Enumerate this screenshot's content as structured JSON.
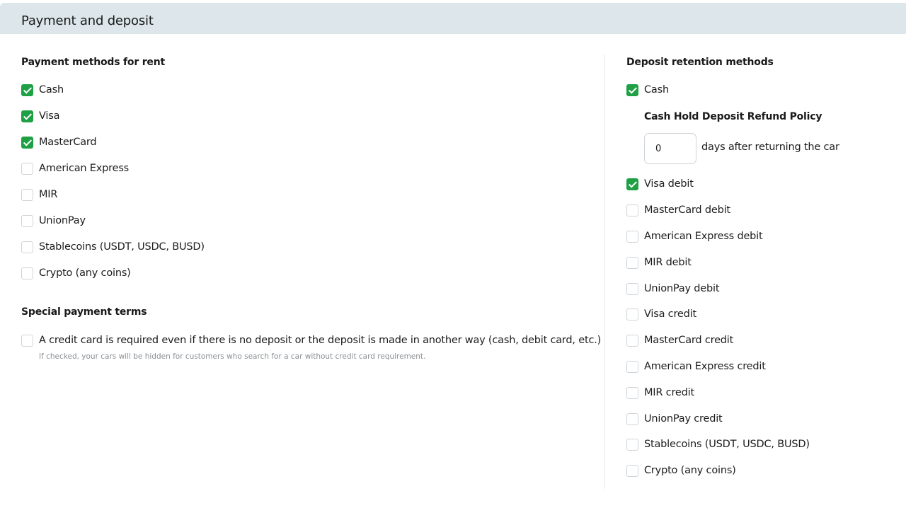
{
  "header": {
    "title": "Payment and deposit"
  },
  "payment_methods": {
    "title": "Payment methods for rent",
    "items": [
      {
        "label": "Cash",
        "checked": true
      },
      {
        "label": "Visa",
        "checked": true
      },
      {
        "label": "MasterCard",
        "checked": true
      },
      {
        "label": "American Express",
        "checked": false
      },
      {
        "label": "MIR",
        "checked": false
      },
      {
        "label": "UnionPay",
        "checked": false
      },
      {
        "label": "Stablecoins (USDT, USDC, BUSD)",
        "checked": false
      },
      {
        "label": "Crypto (any coins)",
        "checked": false
      }
    ]
  },
  "special_terms": {
    "title": "Special payment terms",
    "credit_card_required": {
      "label": "A credit card is required even if there is no deposit or the deposit is made in another way (cash, debit card, etc.)",
      "checked": false,
      "hint": "If checked, your cars will be hidden for customers who search for a car without credit card requirement."
    }
  },
  "deposit_methods": {
    "title": "Deposit retention methods",
    "cash": {
      "label": "Cash",
      "checked": true
    },
    "refund_policy": {
      "title": "Cash Hold Deposit Refund Policy",
      "days_value": "0",
      "suffix": "days after returning the car"
    },
    "items": [
      {
        "label": "Visa debit",
        "checked": true
      },
      {
        "label": "MasterCard debit",
        "checked": false
      },
      {
        "label": "American Express debit",
        "checked": false
      },
      {
        "label": "MIR debit",
        "checked": false
      },
      {
        "label": "UnionPay debit",
        "checked": false
      },
      {
        "label": "Visa credit",
        "checked": false
      },
      {
        "label": "MasterCard credit",
        "checked": false
      },
      {
        "label": "American Express credit",
        "checked": false
      },
      {
        "label": "MIR credit",
        "checked": false
      },
      {
        "label": "UnionPay credit",
        "checked": false
      },
      {
        "label": "Stablecoins (USDT, USDC, BUSD)",
        "checked": false
      },
      {
        "label": "Crypto (any coins)",
        "checked": false
      }
    ]
  },
  "colors": {
    "header_bg": "#dde6ea",
    "checkbox_checked": "#1fa045",
    "checkbox_border": "#cfd4d8",
    "hint_text": "#8a8f93"
  },
  "icons": {
    "checked": "check-icon"
  }
}
